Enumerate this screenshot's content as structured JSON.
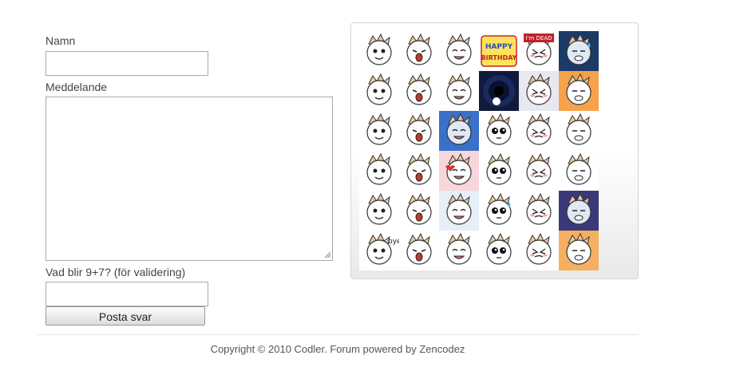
{
  "form": {
    "name_label": "Namn",
    "name_value": "",
    "message_label": "Meddelande",
    "message_value": "",
    "captcha_label": "Vad blir 9+7? (för validering)",
    "captcha_value": "",
    "submit_label": "Posta svar"
  },
  "emoticons": {
    "count": 36,
    "items": [
      {
        "name": "emoticon-brushing-teeth",
        "bg": "#ffffff",
        "tag": ""
      },
      {
        "name": "emoticon-crying-tears",
        "bg": "#ffffff",
        "tag": ""
      },
      {
        "name": "emoticon-smug",
        "bg": "#ffffff",
        "tag": ""
      },
      {
        "name": "emoticon-happy-birthday",
        "bg": "#ffffff",
        "tag": "HAPPY BIRTHDAY"
      },
      {
        "name": "emoticon-im-dead",
        "bg": "#ffffff",
        "tag": "I'm DEAD"
      },
      {
        "name": "emoticon-sweat-drops",
        "bg": "#1c3a66",
        "tag": ""
      },
      {
        "name": "emoticon-nosebleed",
        "bg": "#ffffff",
        "tag": ""
      },
      {
        "name": "emoticon-shocked-laugh",
        "bg": "#ffffff",
        "tag": ""
      },
      {
        "name": "emoticon-angry-shout",
        "bg": "#ffffff",
        "tag": ""
      },
      {
        "name": "emoticon-vortex",
        "bg": "#101a3c",
        "tag": ""
      },
      {
        "name": "emoticon-scream",
        "bg": "#e8e8f0",
        "tag": ""
      },
      {
        "name": "emoticon-fire-rage",
        "bg": "#f5a24a",
        "tag": ""
      },
      {
        "name": "emoticon-peace-grin",
        "bg": "#ffffff",
        "tag": ""
      },
      {
        "name": "emoticon-dizzy",
        "bg": "#ffffff",
        "tag": ""
      },
      {
        "name": "emoticon-frozen",
        "bg": "#3a70c8",
        "tag": ""
      },
      {
        "name": "emoticon-blush-shy",
        "bg": "#ffffff",
        "tag": ""
      },
      {
        "name": "emoticon-big-eyes",
        "bg": "#ffffff",
        "tag": ""
      },
      {
        "name": "emoticon-laughing",
        "bg": "#ffffff",
        "tag": ""
      },
      {
        "name": "emoticon-yelling",
        "bg": "#ffffff",
        "tag": ""
      },
      {
        "name": "emoticon-two-faces",
        "bg": "#ffffff",
        "tag": ""
      },
      {
        "name": "emoticon-love-hearts",
        "bg": "#f7d6dc",
        "tag": ""
      },
      {
        "name": "emoticon-annoyed",
        "bg": "#ffffff",
        "tag": ""
      },
      {
        "name": "emoticon-pouting",
        "bg": "#ffffff",
        "tag": ""
      },
      {
        "name": "emoticon-blushing",
        "bg": "#ffffff",
        "tag": ""
      },
      {
        "name": "emoticon-grinning",
        "bg": "#ffffff",
        "tag": ""
      },
      {
        "name": "emoticon-content",
        "bg": "#ffffff",
        "tag": ""
      },
      {
        "name": "emoticon-thinking",
        "bg": "#e6eef8",
        "tag": ""
      },
      {
        "name": "emoticon-sweat-drop",
        "bg": "#ffffff",
        "tag": ""
      },
      {
        "name": "emoticon-cheering",
        "bg": "#ffffff",
        "tag": ""
      },
      {
        "name": "emoticon-gloomy",
        "bg": "#3a3a7a",
        "tag": ""
      },
      {
        "name": "emoticon-bye",
        "bg": "#ffffff",
        "tag": "bye"
      },
      {
        "name": "emoticon-sobbing",
        "bg": "#ffffff",
        "tag": ""
      },
      {
        "name": "emoticon-grimace",
        "bg": "#ffffff",
        "tag": ""
      },
      {
        "name": "emoticon-sleepy",
        "bg": "#ffffff",
        "tag": ""
      },
      {
        "name": "emoticon-facepalm",
        "bg": "#ffffff",
        "tag": ""
      },
      {
        "name": "emoticon-scared",
        "bg": "#f4b060",
        "tag": ""
      }
    ]
  },
  "footer": {
    "text": "Copyright © 2010 Codler. Forum powered by Zencodez"
  }
}
